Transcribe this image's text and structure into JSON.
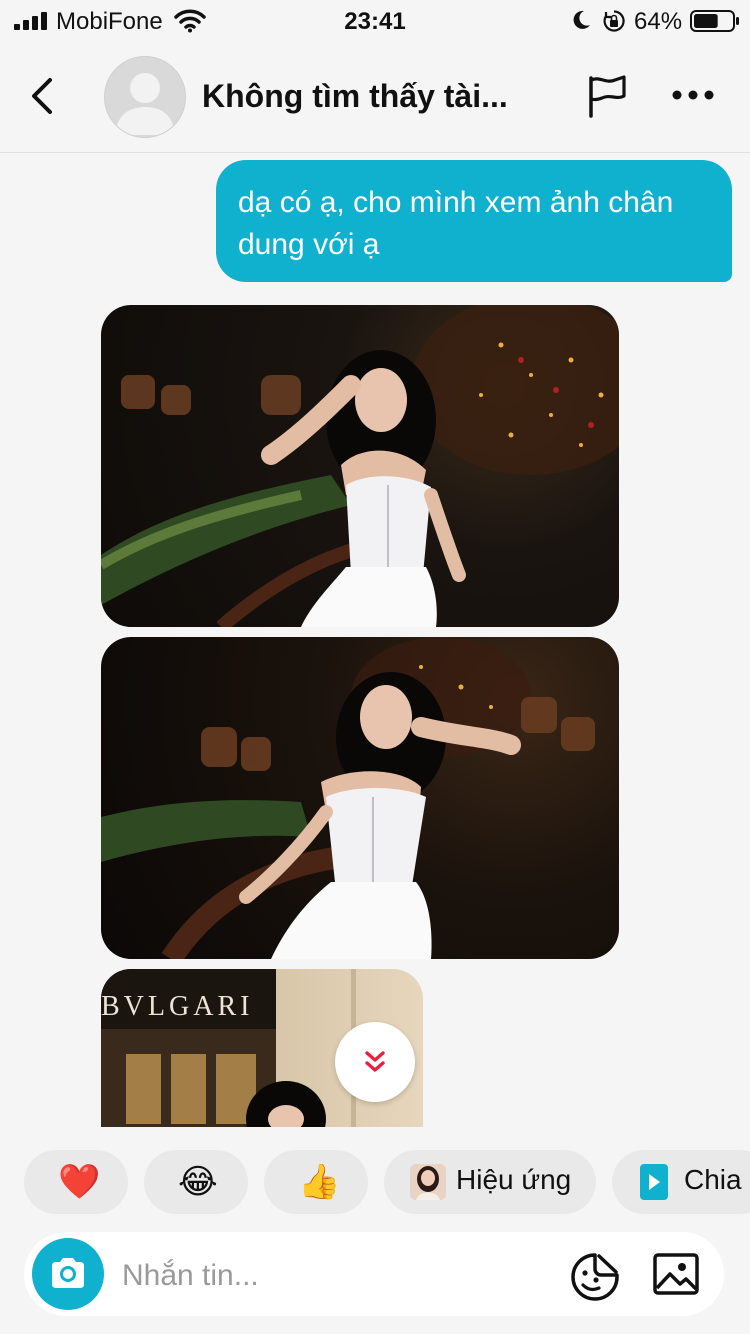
{
  "status": {
    "carrier": "MobiFone",
    "time": "23:41",
    "battery": "64%",
    "battery_level": 0.64
  },
  "header": {
    "title": "Không tìm thấy tài..."
  },
  "messages": [
    {
      "type": "text",
      "text": "dạ có ạ, cho mình xem ảnh chân dung với ạ"
    }
  ],
  "photos": [
    {
      "brand_sign": ""
    },
    {
      "brand_sign": ""
    },
    {
      "brand_sign": "BVLGARI"
    }
  ],
  "quick_replies": [
    {
      "icon": "heart-emoji",
      "emoji": "❤️"
    },
    {
      "icon": "laughing-tears-emoji",
      "emoji": "😂"
    },
    {
      "icon": "thumbs-up-emoji",
      "emoji": "👍"
    },
    {
      "icon": "effect-thumbnail",
      "label": "Hiệu ứng"
    },
    {
      "icon": "share-play-icon",
      "label": "Chia"
    }
  ],
  "composer": {
    "placeholder": "Nhắn tin..."
  },
  "colors": {
    "accent": "#10b1cf",
    "background": "#f5f5f5",
    "chip": "#e9e9e9"
  }
}
